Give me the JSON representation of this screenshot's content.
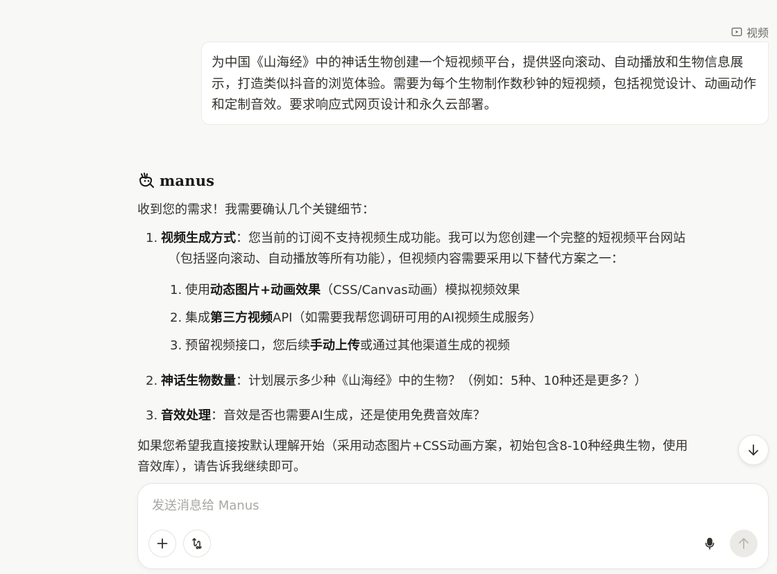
{
  "header": {
    "tag_label": "视频",
    "tag_icon": "video-icon"
  },
  "user_message": {
    "text": "为中国《山海经》中的神话生物创建一个短视频平台，提供竖向滚动、自动播放和生物信息展示，打造类似抖音的浏览体验。需要为每个生物制作数秒钟的短视频，包括视觉设计、动画动作和定制音效。要求响应式网页设计和永久云部署。"
  },
  "assistant": {
    "name": "manus",
    "logo_icon": "manus-logo-icon",
    "intro": "收到您的需求！我需要确认几个关键细节：",
    "items": [
      {
        "num": "1.",
        "title": "视频生成方式",
        "text_line1": "：您当前的订阅不支持视频生成功能。我可以为您创建一个完整的短视频平台网站",
        "text_line2": "（包括竖向滚动、自动播放等所有功能），但视频内容需要采用以下替代方案之一：",
        "subitems": [
          {
            "num": "1.",
            "pre": "使用",
            "bold": "动态图片+动画效果",
            "post": "（CSS/Canvas动画）模拟视频效果"
          },
          {
            "num": "2.",
            "pre": "集成",
            "bold": "第三方视频",
            "post": "API（如需要我帮您调研可用的AI视频生成服务）"
          },
          {
            "num": "3.",
            "pre": "预留视频接口，您后续",
            "bold": "手动上传",
            "post": "或通过其他渠道生成的视频"
          }
        ]
      },
      {
        "num": "2.",
        "title": "神话生物数量",
        "text": "：计划展示多少种《山海经》中的生物？（例如：5种、10种还是更多？）"
      },
      {
        "num": "3.",
        "title": "音效处理",
        "text": "：音效是否也需要AI生成，还是使用免费音效库？"
      }
    ],
    "final_line1": "如果您希望我直接按默认理解开始（采用动态图片+CSS动画方案，初始包含8-10种经典生物，使用",
    "final_line2": "音效库），请告诉我继续即可。"
  },
  "scroll_button": {
    "icon": "arrow-down-icon"
  },
  "composer": {
    "placeholder": "发送消息给 Manus",
    "value": "",
    "add_icon": "plus-icon",
    "tools_icon": "tools-icon",
    "mic_icon": "microphone-icon",
    "send_icon": "arrow-up-icon"
  },
  "colors": {
    "background": "#f8f8f7",
    "text": "#34322d",
    "bubble": "#ffffff",
    "send_disabled": "#eceae6"
  }
}
